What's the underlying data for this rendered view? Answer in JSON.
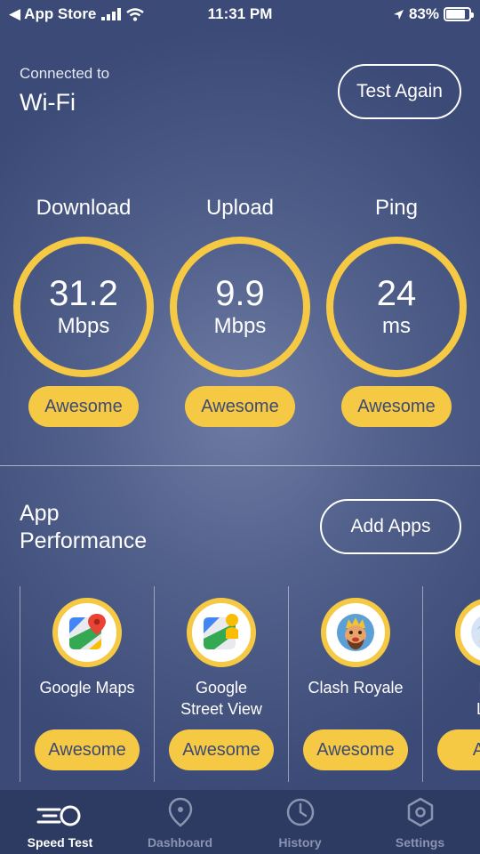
{
  "status_bar": {
    "back_app": "◀ App Store",
    "time": "11:31 PM",
    "battery": "83%",
    "battery_level": 0.83
  },
  "connection": {
    "label": "Connected to",
    "value": "Wi-Fi"
  },
  "test_again_label": "Test Again",
  "metrics": [
    {
      "title": "Download",
      "value": "31.2",
      "unit": "Mbps",
      "rating": "Awesome"
    },
    {
      "title": "Upload",
      "value": "9.9",
      "unit": "Mbps",
      "rating": "Awesome"
    },
    {
      "title": "Ping",
      "value": "24",
      "unit": "ms",
      "rating": "Awesome"
    }
  ],
  "app_performance": {
    "title_line1": "App",
    "title_line2": "Performance",
    "add_label": "Add Apps",
    "apps": [
      {
        "name_line1": "Google Maps",
        "name_line2": "",
        "rating": "Awesome",
        "icon": "google-maps-icon"
      },
      {
        "name_line1": "Google",
        "name_line2": "Street View",
        "rating": "Awesome",
        "icon": "street-view-icon"
      },
      {
        "name_line1": "Clash Royale",
        "name_line2": "",
        "rating": "Awesome",
        "icon": "clash-royale-icon"
      },
      {
        "name_line1": "Mo",
        "name_line2": "Leg",
        "rating": "Awe",
        "icon": "mobile-legends-icon"
      }
    ]
  },
  "tabs": [
    {
      "label": "Speed Test",
      "icon": "speedometer-icon",
      "active": true
    },
    {
      "label": "Dashboard",
      "icon": "location-pin-icon",
      "active": false
    },
    {
      "label": "History",
      "icon": "clock-icon",
      "active": false
    },
    {
      "label": "Settings",
      "icon": "gear-icon",
      "active": false
    }
  ],
  "colors": {
    "accent": "#f6c945",
    "background": "#52618c",
    "tab_bar": "#2d3a62",
    "pill_text": "#3d4a74"
  }
}
